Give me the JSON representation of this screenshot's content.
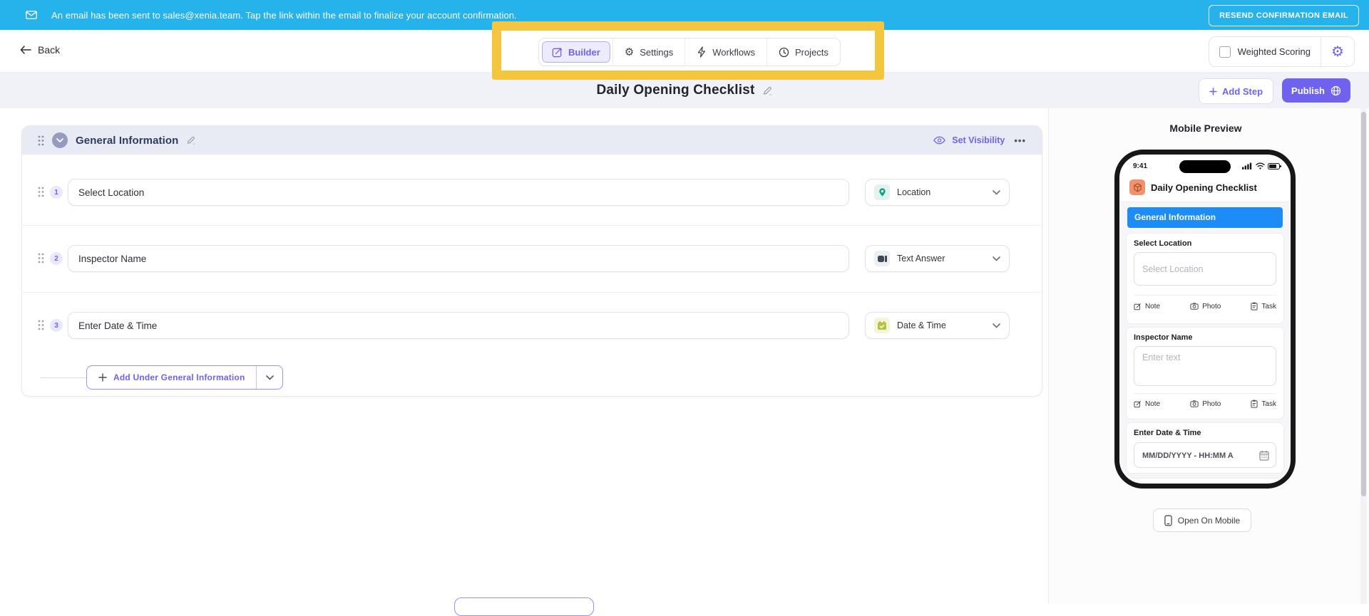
{
  "banner": {
    "message": "An email has been sent to sales@xenia.team. Tap the link within the email to finalize your account confirmation.",
    "resend_label": "RESEND CONFIRMATION EMAIL"
  },
  "nav": {
    "back_label": "Back",
    "tabs": [
      {
        "label": "Builder",
        "icon": "pencil-square-icon",
        "active": true
      },
      {
        "label": "Settings",
        "icon": "gear-icon",
        "active": false
      },
      {
        "label": "Workflows",
        "icon": "lightning-icon",
        "active": false
      },
      {
        "label": "Projects",
        "icon": "clock-icon",
        "active": false
      }
    ],
    "weighted_scoring_label": "Weighted Scoring",
    "gear_glyph": "⚙"
  },
  "header": {
    "title": "Daily Opening Checklist",
    "add_step_label": "Add Step",
    "publish_label": "Publish"
  },
  "builder": {
    "section_title": "General Information",
    "set_visibility_label": "Set Visibility",
    "more_label": "•••",
    "steps": [
      {
        "number": "1",
        "label": "Select Location",
        "type": "Location",
        "type_icon": "location-pin-icon"
      },
      {
        "number": "2",
        "label": "Inspector Name",
        "type": "Text Answer",
        "type_icon": "text-answer-icon"
      },
      {
        "number": "3",
        "label": "Enter Date & Time",
        "type": "Date & Time",
        "type_icon": "calendar-icon"
      }
    ],
    "add_under_label": "Add Under General Information"
  },
  "preview": {
    "panel_title": "Mobile Preview",
    "open_on_mobile_label": "Open On Mobile",
    "phone": {
      "status_time": "9:41",
      "app_title": "Daily Opening Checklist",
      "section_title": "General Information",
      "actions": {
        "note": "Note",
        "photo": "Photo",
        "task": "Task"
      },
      "fields": [
        {
          "label": "Select Location",
          "placeholder": "Select Location"
        },
        {
          "label": "Inspector Name",
          "placeholder": "Enter text"
        },
        {
          "label": "Enter Date & Time",
          "placeholder": "MM/DD/YYYY - HH:MM A"
        }
      ]
    }
  },
  "colors": {
    "accent_purple": "#6f63ee",
    "banner_blue": "#26b2ea",
    "highlight_yellow": "#f4c63e",
    "mobile_blue": "#1e8cf7",
    "location_teal": "#12a188",
    "date_olive": "#b6c23a",
    "app_icon_orange": "#f0926f"
  }
}
